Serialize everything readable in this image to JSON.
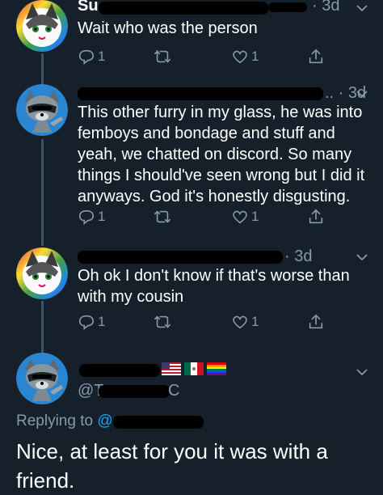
{
  "tweets": [
    {
      "name_visible": "Su",
      "time": "3d",
      "text": "Wait who was the person",
      "replies": "1",
      "likes": "1"
    },
    {
      "time": "3d",
      "text": "This other furry in my glass, he was into femboys and bondage and stuff and yeah, we chatted on discord. So many things I should've seen wrong but I did it anyways. God it's honestly disgusting.",
      "replies": "1",
      "likes": "1"
    },
    {
      "time": "3d",
      "text": "Oh ok I don't know if that's worse than with my cousin",
      "replies": "1",
      "likes": "1"
    }
  ],
  "focused_tweet": {
    "handle_visible": "@T",
    "handle_tail": "C",
    "replying_prefix": "Replying to",
    "replying_mention": "@",
    "text": "Nice, at least for you it was with a friend."
  },
  "icons": {
    "reply": "reply-icon",
    "retweet": "retweet-icon",
    "like": "heart-icon",
    "share": "share-icon",
    "more": "chevron-down-icon"
  },
  "colors": {
    "background": "#15202b",
    "secondary_text": "#8899a6",
    "thread_line": "#3d5466",
    "link": "#1da1f2"
  }
}
